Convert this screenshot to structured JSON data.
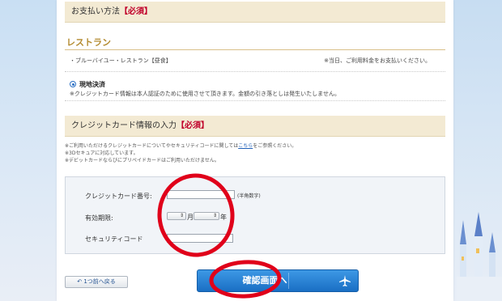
{
  "payment": {
    "heading": "お支払い方法",
    "required": "【必須】",
    "restaurant_title": "レストラン",
    "item_name": "・ブルーバイユー・レストラン【昼食】",
    "item_note": "※当日、ご利用料金をお支払いください。",
    "option_label": "現地決済",
    "option_note": "※クレジットカード情報は本人認証のために使用させて頂きます。金額の引き落としは発生いたしません。"
  },
  "card": {
    "heading": "クレジットカード情報の入力",
    "required": "【必須】",
    "note1_pre": "※ご利用いただけるクレジットカードについてやセキュリティコードに関しては",
    "note1_link": "こちら",
    "note1_post": "をご参照ください。",
    "note2": "※3Dセキュアに対応しています。",
    "note3": "※デビットカードならびにプリペイドカードはご利用いただけません。"
  },
  "form": {
    "card_number_label": "クレジットカード番号:",
    "card_number_hint": "(半角数字)",
    "expiry_label": "有効期限:",
    "month_unit": "月",
    "year_unit": "年",
    "security_label": "セキュリティコード"
  },
  "buttons": {
    "back": "1つ前へ戻る",
    "confirm": "確認画面へ"
  },
  "colors": {
    "section_bg": "#f3ead3",
    "required": "#c0002a",
    "gold": "#b38a2e",
    "confirm_button": "#1a6fc4",
    "annotation": "#e0001a"
  }
}
